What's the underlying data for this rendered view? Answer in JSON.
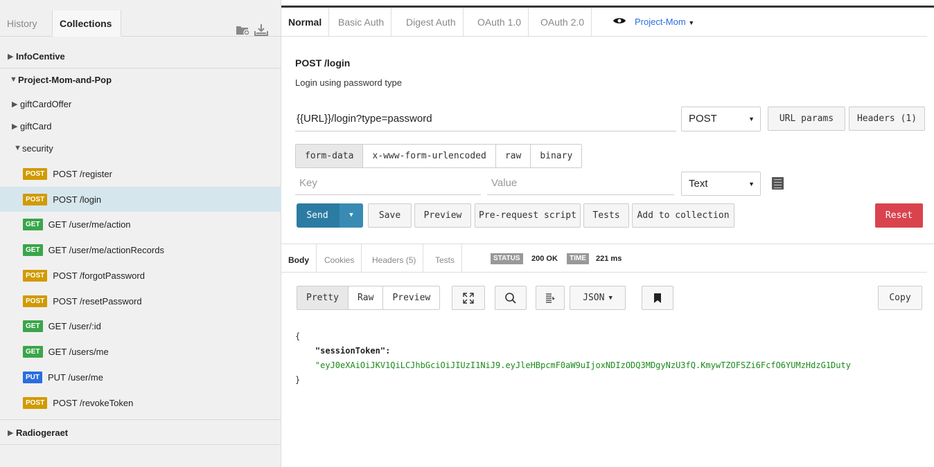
{
  "sidebar": {
    "tabs": [
      {
        "label": "History"
      },
      {
        "label": "Collections"
      }
    ],
    "collections": [
      {
        "name": "InfoCentive"
      },
      {
        "name": "Project-Mom-and-Pop"
      },
      {
        "name": "Radiogeraet"
      }
    ],
    "folders": [
      {
        "name": "giftCardOffer"
      },
      {
        "name": "giftCard"
      },
      {
        "name": "security"
      }
    ],
    "requests": [
      {
        "method": "POST",
        "label": "POST /register"
      },
      {
        "method": "POST",
        "label": "POST /login"
      },
      {
        "method": "GET",
        "label": "GET /user/me/action"
      },
      {
        "method": "GET",
        "label": "GET /user/me/actionRecords"
      },
      {
        "method": "POST",
        "label": "POST /forgotPassword"
      },
      {
        "method": "POST",
        "label": "POST /resetPassword"
      },
      {
        "method": "GET",
        "label": "GET /user/:id"
      },
      {
        "method": "GET",
        "label": "GET /users/me"
      },
      {
        "method": "PUT",
        "label": "PUT /user/me"
      },
      {
        "method": "POST",
        "label": "POST /revokeToken"
      }
    ],
    "selected_request": "POST /login"
  },
  "auth_tabs": [
    {
      "label": "Normal"
    },
    {
      "label": "Basic Auth"
    },
    {
      "label": "Digest Auth"
    },
    {
      "label": "OAuth 1.0"
    },
    {
      "label": "OAuth 2.0"
    }
  ],
  "environment": {
    "label": "Project-Mom"
  },
  "request": {
    "title": "POST /login",
    "description": "Login using password type",
    "url": "{{URL}}/login?type=password",
    "method": "POST",
    "url_params_label": "URL params",
    "headers_label": "Headers (1)"
  },
  "body_tabs": [
    {
      "label": "form-data"
    },
    {
      "label": "x-www-form-urlencoded"
    },
    {
      "label": "raw"
    },
    {
      "label": "binary"
    }
  ],
  "form": {
    "key_placeholder": "Key",
    "value_placeholder": "Value",
    "type": "Text"
  },
  "actions": {
    "send": "Send",
    "save": "Save",
    "preview": "Preview",
    "pre_request": "Pre-request script",
    "tests": "Tests",
    "add_to_collection": "Add to collection",
    "reset": "Reset"
  },
  "response": {
    "tabs": [
      {
        "label": "Body"
      },
      {
        "label": "Cookies"
      },
      {
        "label": "Headers (5)"
      },
      {
        "label": "Tests"
      }
    ],
    "status_label": "STATUS",
    "status_value": "200 OK",
    "time_label": "TIME",
    "time_value": "221 ms",
    "view_buttons": [
      {
        "label": "Pretty"
      },
      {
        "label": "Raw"
      },
      {
        "label": "Preview"
      }
    ],
    "format": "JSON",
    "copy_label": "Copy",
    "body": {
      "open_brace": "{",
      "key": "\"sessionToken\"",
      "colon": ":",
      "value": "\"eyJ0eXAiOiJKV1QiLCJhbGciOiJIUzI1NiJ9.eyJleHBpcmF0aW9uIjoxNDIzODQ3MDgyNzU3fQ.KmywTZOFSZi6FcfO6YUMzHdzG1Duty",
      "close_brace": "}"
    }
  },
  "colors": {
    "send": "#2c7ba3",
    "reset": "#d9434e",
    "post": "#d19a00",
    "get": "#3aa54a",
    "put": "#2a6de0",
    "selected_row": "#d6e6ed",
    "json_string": "#1a8a1a"
  },
  "icons": {
    "new_collection": "folder-plus-icon",
    "import": "import-icon",
    "environment": "eye-icon",
    "fullscreen": "expand-icon",
    "search": "search-icon",
    "wrap": "wrap-lines-icon",
    "bookmark": "bookmark-icon",
    "bulk_edit": "bulk-edit-icon"
  }
}
